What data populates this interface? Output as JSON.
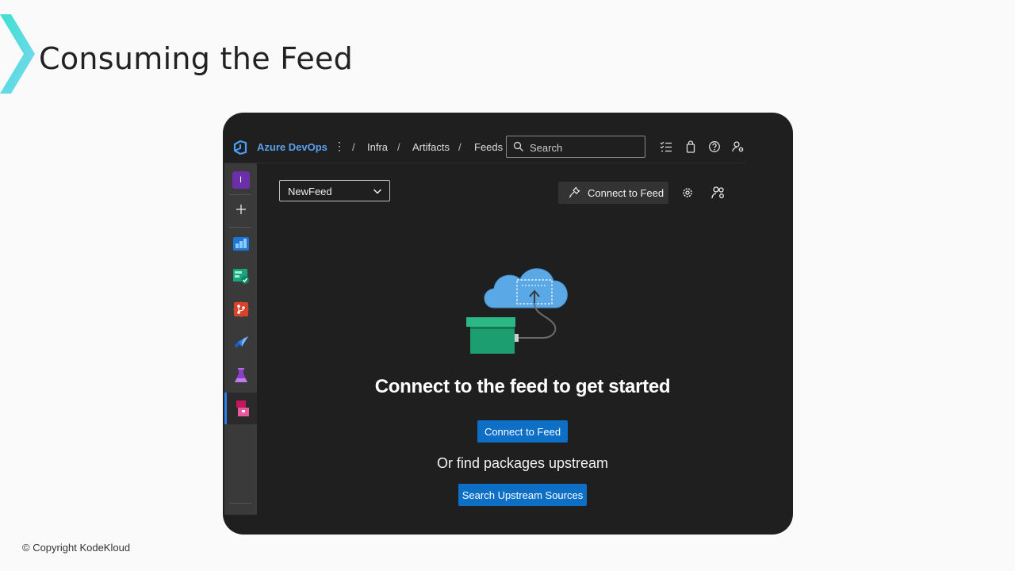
{
  "slide": {
    "title": "Consuming the Feed",
    "copyright": "© Copyright KodeKloud"
  },
  "topbar": {
    "brand": "Azure DevOps",
    "breadcrumbs": [
      "Infra",
      "Artifacts",
      "Feeds"
    ],
    "search_placeholder": "Search",
    "icons": [
      "task-list-icon",
      "shopping-bag-icon",
      "help-icon",
      "user-settings-icon"
    ]
  },
  "sidebar": {
    "project_initial": "I",
    "items": [
      "add-icon",
      "boards-icon",
      "test-plans-icon",
      "repos-icon",
      "pipelines-icon",
      "test-lab-icon",
      "artifacts-icon"
    ]
  },
  "feed": {
    "selected": "NewFeed",
    "connect_button_top": "Connect to Feed"
  },
  "empty_state": {
    "headline": "Connect to the feed to get started",
    "connect_button": "Connect to Feed",
    "subtext": "Or find packages upstream",
    "search_button": "Search Upstream Sources"
  },
  "colors": {
    "accent": "#0e6fc7",
    "brand": "#5ca0f0",
    "background": "#1f1f1f",
    "sidebar": "#3a3a3a"
  }
}
